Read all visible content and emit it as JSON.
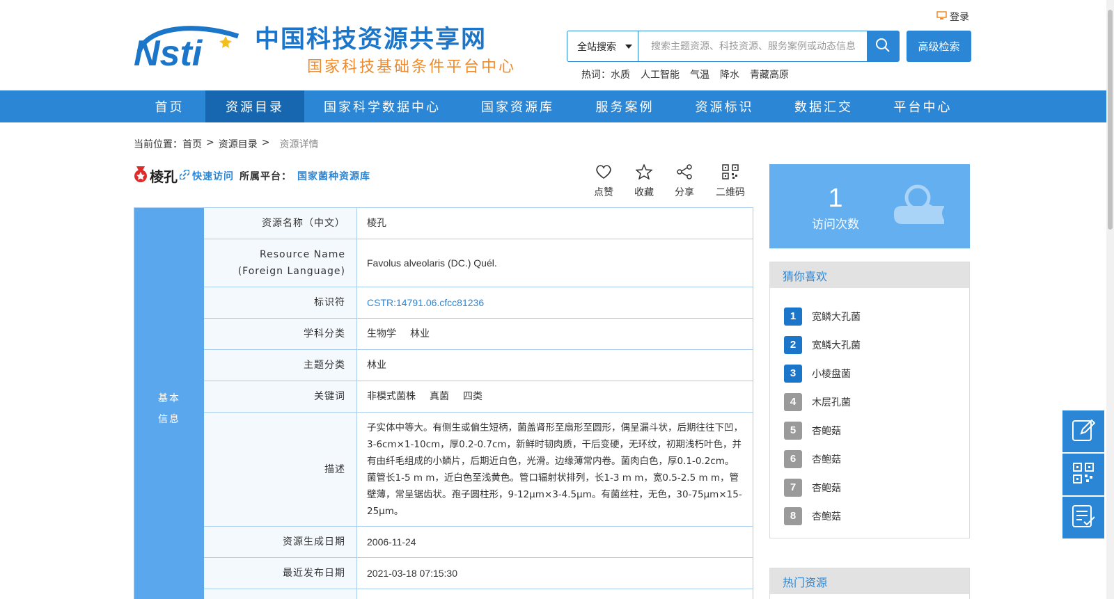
{
  "header": {
    "site_title": "中国科技资源共享网",
    "site_subtitle": "国家科技基础条件平台中心",
    "login_label": "登录",
    "search": {
      "scope": "全站搜索",
      "placeholder": "搜索主题资源、科技资源、服务案例或动态信息",
      "advanced_label": "高级检索"
    },
    "hot": {
      "label": "热词：",
      "words": [
        "水质",
        "人工智能",
        "气温",
        "降水",
        "青藏高原"
      ]
    }
  },
  "nav": {
    "items": [
      {
        "label": "首页",
        "active": false
      },
      {
        "label": "资源目录",
        "active": true
      },
      {
        "label": "国家科学数据中心",
        "active": false
      },
      {
        "label": "国家资源库",
        "active": false
      },
      {
        "label": "服务案例",
        "active": false
      },
      {
        "label": "资源标识",
        "active": false
      },
      {
        "label": "数据汇交",
        "active": false
      },
      {
        "label": "平台中心",
        "active": false
      }
    ]
  },
  "breadcrumb": {
    "prefix": "当前位置：",
    "home": "首页",
    "sep1": ">",
    "catalog": "资源目录",
    "sep2": ">",
    "current": "资源详情"
  },
  "resource": {
    "title": "棱孔",
    "quick_visit": "快速访问",
    "platform_label": "所属平台：",
    "platform_name": "国家菌种资源库"
  },
  "actions": {
    "like": "点赞",
    "favorite": "收藏",
    "share": "分享",
    "qrcode": "二维码"
  },
  "table": {
    "side_label_1": "基本",
    "side_label_2": "信息",
    "name_cn_label": "资源名称（中文）",
    "name_cn": "棱孔",
    "name_en_label_1": "Resource Name",
    "name_en_label_2": "(Foreign Language)",
    "name_en": "Favolus alveolaris (DC.) Quél.",
    "id_label": "标识符",
    "id_value": "CSTR:14791.06.cfcc81236",
    "subject_label": "学科分类",
    "subjects": [
      "生物学",
      "林业"
    ],
    "topic_label": "主题分类",
    "topic": "林业",
    "keyword_label": "关键词",
    "keywords": [
      "非模式菌株",
      "真菌",
      "四类"
    ],
    "desc_label": "描述",
    "description": "子实体中等大。有侧生或偏生短柄，菌盖肾形至扇形至圆形，偶呈漏斗状，后期往往下凹，3-6cm×1-10cm，厚0.2-0.7cm，新鲜时韧肉质，干后变硬，无环纹，初期浅朽叶色，并有由纤毛组成的小鳞片，后期近白色，光滑。边缘薄常内卷。菌肉白色，厚0.1-0.2cm。菌管长1-5 m m，近白色至浅黄色。管口辐射状排列，长1-3 m m，宽0.5-2.5 m m，管壁薄，常呈锯齿状。孢子圆柱形，9-12μm×3-4.5μm。有菌丝柱，无色，30-75μm×15-25μm。",
    "created_label": "资源生成日期",
    "created": "2006-11-24",
    "published_label": "最近发布日期",
    "published": "2021-03-18 07:15:30"
  },
  "visits": {
    "count": "1",
    "label": "访问次数"
  },
  "guess": {
    "title": "猜你喜欢",
    "items": [
      {
        "num": "1",
        "name": "宽鳞大孔菌"
      },
      {
        "num": "2",
        "name": "宽鳞大孔菌"
      },
      {
        "num": "3",
        "name": "小棱盘菌"
      },
      {
        "num": "4",
        "name": "木层孔菌"
      },
      {
        "num": "5",
        "name": "杏鲍菇"
      },
      {
        "num": "6",
        "name": "杏鲍菇"
      },
      {
        "num": "7",
        "name": "杏鲍菇"
      },
      {
        "num": "8",
        "name": "杏鲍菇"
      }
    ]
  },
  "hot_resources": {
    "title": "热门资源"
  },
  "colors": {
    "primary": "#2c86d6",
    "nav_active": "#1766b0",
    "side_label": "#5aa7ee",
    "accent_orange": "#ef8b2b"
  },
  "icons": [
    "monitor-icon",
    "search-icon",
    "medal-icon",
    "link-icon",
    "heart-icon",
    "star-icon",
    "share-icon",
    "qrcode-icon",
    "magnifier-book-icon",
    "edit-icon",
    "checklist-icon"
  ]
}
